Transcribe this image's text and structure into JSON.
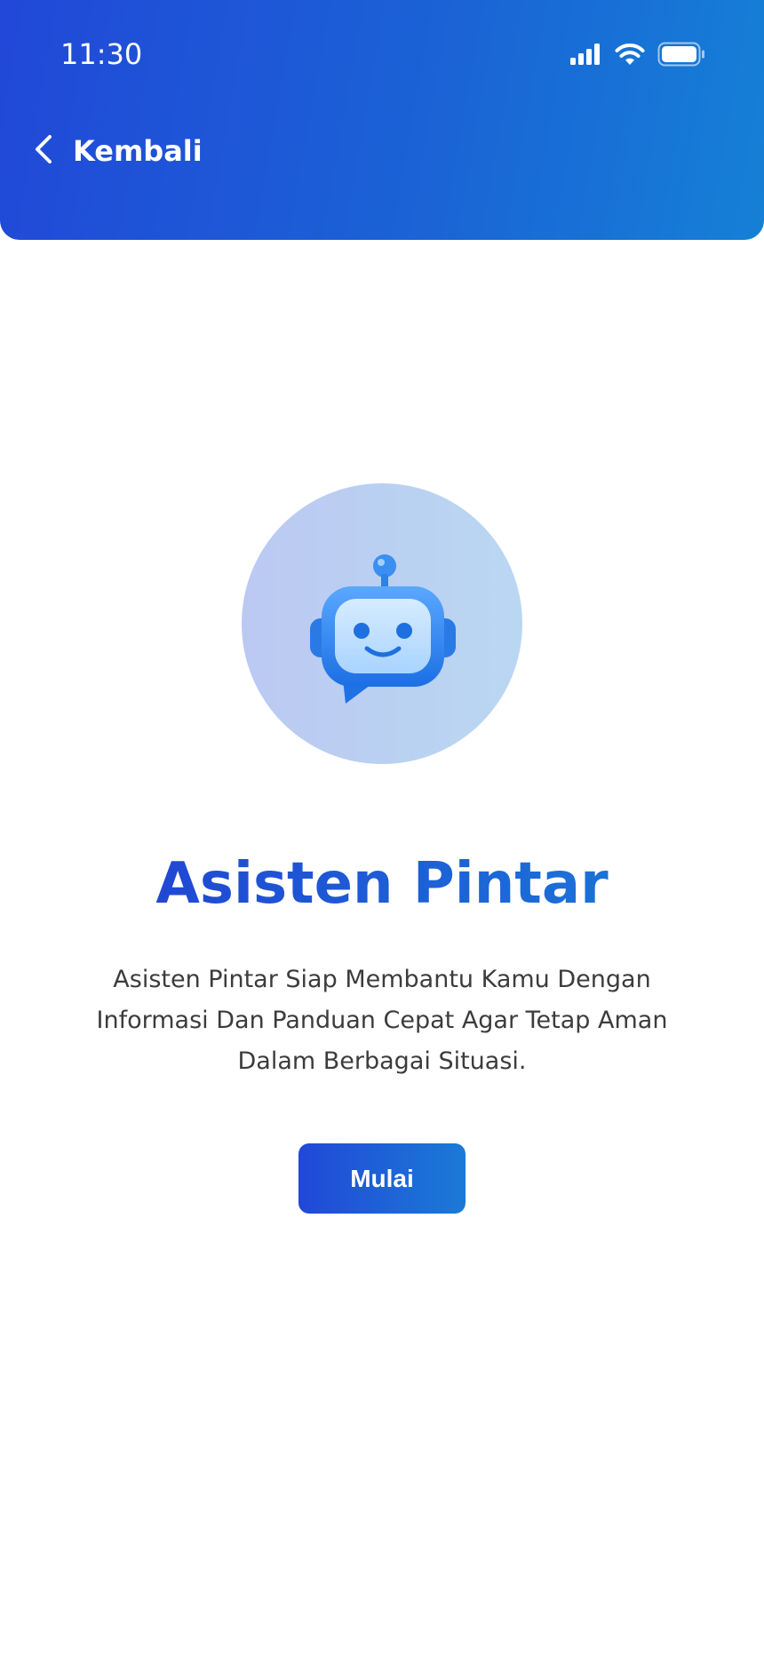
{
  "status_bar": {
    "time": "11:30",
    "icons": [
      "signal-icon",
      "wifi-icon",
      "battery-icon"
    ]
  },
  "header": {
    "back_label": "Kembali",
    "back_icon": "chevron-left-icon",
    "gradient_start": "#2148d8",
    "gradient_end": "#1580d6"
  },
  "hero": {
    "icon": "robot-chat-icon"
  },
  "main": {
    "title": "Asisten Pintar",
    "description": "Asisten Pintar Siap Membantu Kamu Dengan Informasi Dan Panduan Cepat Agar Tetap Aman Dalam Berbagai Situasi.",
    "start_button": "Mulai"
  }
}
